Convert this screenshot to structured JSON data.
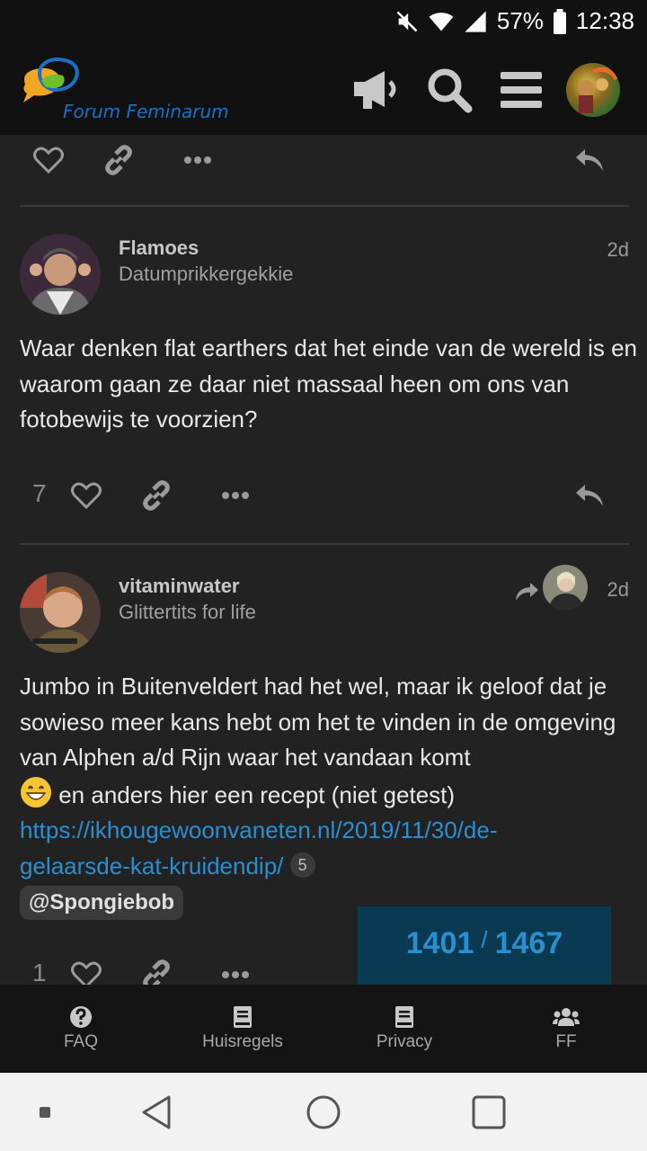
{
  "status_bar": {
    "battery": "57%",
    "time": "12:38",
    "icons": [
      "mute-icon",
      "wifi-icon",
      "signal-icon",
      "battery-icon"
    ]
  },
  "header": {
    "logo_text": "Forum Feminarum",
    "buttons": [
      "megaphone-icon",
      "search-icon",
      "hamburger-menu-icon",
      "user-avatar"
    ]
  },
  "posts": [
    {
      "username": "Flamoes",
      "user_title": "Datumprikkergekkie",
      "date": "2d",
      "body": "Waar denken flat earthers dat het einde van de wereld is en waarom gaan ze daar niet massaal heen om ons van fotobewijs te voorzien?",
      "likes": "7"
    },
    {
      "username": "vitaminwater",
      "user_title": "Glittertits for life",
      "date": "2d",
      "body_text": "Jumbo in Buitenveldert had het wel, maar ik geloof dat je sowieso meer kans hebt om het te vinden in de omgeving van Alphen a/d Rijn waar het vandaan komt",
      "body_after_emoji": " en anders hier een recept (niet getest)",
      "link_line1": "https://ikhougewoonvaneten.nl/2019/11/30/de-",
      "link_line2": "gelaarsde-kat-kruidendip/",
      "link_clicks": "5",
      "mention": "@Spongiebob",
      "likes": "1"
    }
  ],
  "progress": {
    "current": "1401",
    "separator": "/",
    "total": "1467"
  },
  "footer": [
    {
      "label": "FAQ",
      "icon": "question-circle-icon"
    },
    {
      "label": "Huisregels",
      "icon": "book-icon"
    },
    {
      "label": "Privacy",
      "icon": "book-icon"
    },
    {
      "label": "FF",
      "icon": "users-icon"
    }
  ],
  "colors": {
    "background": "#222222",
    "header": "#111111",
    "link": "#2a8fd0",
    "progress_bg": "#0a3a52"
  }
}
